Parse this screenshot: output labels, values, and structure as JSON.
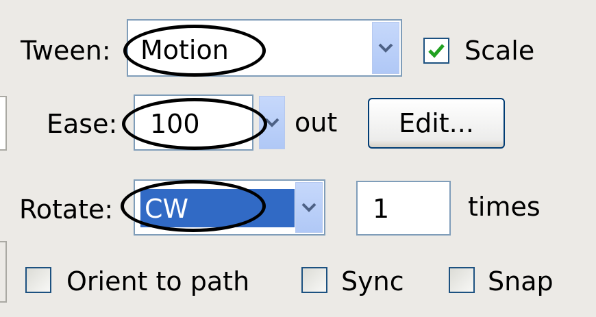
{
  "tween": {
    "label": "Tween:",
    "value": "Motion"
  },
  "scale": {
    "label": "Scale",
    "checked": true
  },
  "ease": {
    "label": "Ease:",
    "value": "100",
    "suffix": "out",
    "edit_button": "Edit..."
  },
  "rotate": {
    "label": "Rotate:",
    "value": "CW",
    "times_value": "1",
    "times_label": "times"
  },
  "options": {
    "orient_to_path": "Orient to path",
    "sync": "Sync",
    "snap": "Snap"
  },
  "colors": {
    "selection": "#316ac5",
    "field_border": "#7f9db9",
    "check_green": "#21a121",
    "panel_bg": "#eceae6"
  },
  "icons": {
    "dropdown": "chevron-down-icon",
    "check": "checkmark-icon"
  }
}
